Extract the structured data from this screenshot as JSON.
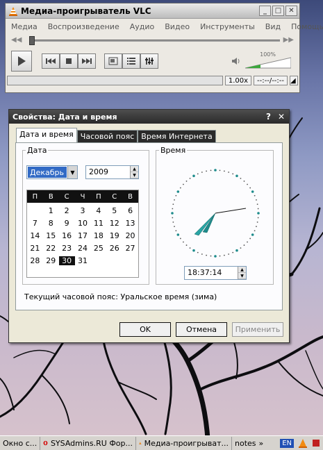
{
  "vlc": {
    "title": "Медиа-проигрыватель VLC",
    "menu": [
      "Медиа",
      "Воспроизведение",
      "Аудио",
      "Видео",
      "Инструменты",
      "Вид",
      "Помощь"
    ],
    "volume_label": "100%",
    "speed": "1.00x",
    "time": "--:--/--:--"
  },
  "dialog": {
    "title": "Свойства: Дата и время",
    "help_glyph": "?",
    "close_glyph": "✕",
    "tabs": [
      "Дата и время",
      "Часовой пояс",
      "Время Интернета"
    ],
    "date_legend": "Дата",
    "time_legend": "Время",
    "month": "Декабрь",
    "year": "2009",
    "weekdays": [
      "П",
      "В",
      "С",
      "Ч",
      "П",
      "С",
      "В"
    ],
    "days": [
      "",
      "1",
      "2",
      "3",
      "4",
      "5",
      "6",
      "7",
      "8",
      "9",
      "10",
      "11",
      "12",
      "13",
      "14",
      "15",
      "16",
      "17",
      "18",
      "19",
      "20",
      "21",
      "22",
      "23",
      "24",
      "25",
      "26",
      "27",
      "28",
      "29",
      "30",
      "31",
      "",
      "",
      ""
    ],
    "selected_day": "30",
    "time": "18:37:14",
    "timezone_text": "Текущий часовой пояс: Уральское время (зима)",
    "ok": "OK",
    "cancel": "Отмена",
    "apply": "Применить"
  },
  "taskbar": {
    "items": [
      "Окно с...",
      "SYSAdmins.RU Фор...",
      "Медиа-проигрыват...",
      "notes"
    ],
    "lang": "EN"
  },
  "colors": {
    "selection": "#316ac5",
    "clock_hands": "#1e8c8c"
  }
}
